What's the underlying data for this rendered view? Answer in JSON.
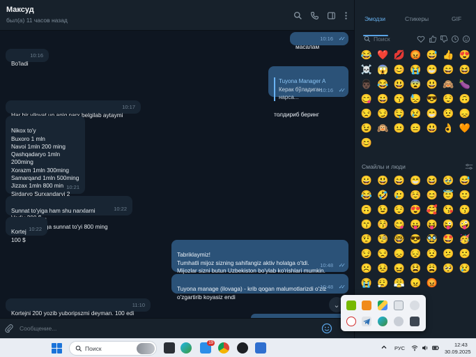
{
  "header": {
    "name": "Максуд",
    "status": "был(а) 11 часов назад"
  },
  "messages": [
    {
      "dir": "out",
      "text": "масалам",
      "time": "10:16",
      "ticks": "✓✓"
    },
    {
      "dir": "in",
      "text": "Bo'ladi",
      "time": "10:16"
    },
    {
      "dir": "out",
      "reply_name": "Tuyona Manager A",
      "reply_text": "Керак бўладиган нарса...",
      "text": "толдириб беринг",
      "time": "10:16",
      "ticks": "✓✓"
    },
    {
      "dir": "in",
      "text": "Har bir viloyat un aniq narx belgilab aytaymi",
      "time": "10:17"
    },
    {
      "dir": "in",
      "text": "Nikox to'y\nBuxoro 1 mln\nNavoi 1mln 200 ming\nQashqadaryo 1mln 200ming\nXorazm 1mln 300ming\nSamarqand 1mln 500ming\nJizzax 1mln 800 min\nSirdaryo Surxandaryi 2 mln\nToshkent 200 $\nVodiy 200 $",
      "time": "10:21"
    },
    {
      "dir": "in",
      "text": "Sunnat to'yiga ham shu narxlarni belgilayvering\nFaqat buxoroga sunnat to'yi 800 ming",
      "time": "10:22"
    },
    {
      "dir": "in",
      "text": "Kortej\n100 $",
      "time": "10:22"
    },
    {
      "dir": "out",
      "text": "Tabriklaymiz!\nTumhatli mijoz sizning sahifangiz aktiv holatga o'tdi.\nMijozlar sizni butun Uzbekiston bo'ylab ko'rishlari mumkin.",
      "time": "10:48",
      "ticks": "✓✓"
    },
    {
      "dir": "out",
      "text": "Tuyona manage (ilovaga) - krib qogan malumotlarizdi o'ziz\no'zgartirib koyasiz endi",
      "time": "10:48",
      "ticks": "✓✓"
    },
    {
      "dir": "in",
      "text": "Kortejni 200 yozib yuboripszmi deyman. 100 edi",
      "time": "11:10"
    }
  ],
  "composer": {
    "placeholder": "Сообщение..."
  },
  "emoji_panel": {
    "tabs": [
      "Эмодзи",
      "Стикеры",
      "GIF"
    ],
    "search_placeholder": "Поиск",
    "section_label": "Смайлы и люди",
    "recent": [
      "😂",
      "❤️",
      "💋",
      "😡",
      "😅",
      "👍",
      "😍",
      "☠️",
      "😱",
      "😊",
      "😭",
      "😁",
      "😄",
      "😆",
      "👨🏿",
      "😂",
      "😃",
      "😨",
      "😃",
      "🙈",
      "🍆",
      "😋",
      "😀",
      "😙",
      "😓",
      "😎",
      "😌",
      "🙃",
      "😒",
      "😏",
      "🤤",
      "😢",
      "😁",
      "😟",
      "😞",
      "😉",
      "🙉",
      "😐",
      "😑",
      "😃",
      "👌",
      "🧡",
      "😊"
    ],
    "people": [
      "😀",
      "😃",
      "😄",
      "😁",
      "😆",
      "🥹",
      "😅",
      "😂",
      "🤣",
      "🥲",
      "☺️",
      "😊",
      "😇",
      "🙂",
      "🙃",
      "😉",
      "😌",
      "😍",
      "🥰",
      "😘",
      "😗",
      "😙",
      "😚",
      "😋",
      "😛",
      "😝",
      "😜",
      "🤪",
      "🤨",
      "🧐",
      "🤓",
      "😎",
      "🥸",
      "🤩",
      "🥳",
      "😏",
      "😒",
      "😞",
      "😔",
      "😟",
      "😕",
      "🙁",
      "☹️",
      "😣",
      "😖",
      "😫",
      "😩",
      "🥺",
      "😢",
      "😭",
      "😮‍💨",
      "😤",
      "😠",
      "😡"
    ]
  },
  "tray_popup": {
    "apps": [
      "nvidia-icon",
      "app-orange-icon",
      "google-drive-icon",
      "usb-icon",
      "chat-icon",
      "yandex-icon",
      "telegram-icon",
      "edge-icon",
      "app-gray-icon",
      "app-dark-icon"
    ]
  },
  "taskbar": {
    "search_label": "Поиск",
    "lang": "РУС",
    "time": "12:43",
    "date": "30.09.2025",
    "badge": "19"
  },
  "colors": {
    "accent": "#5aa4e6",
    "outgoing": "#2b5278",
    "incoming": "#182533",
    "background": "#0e1621"
  }
}
